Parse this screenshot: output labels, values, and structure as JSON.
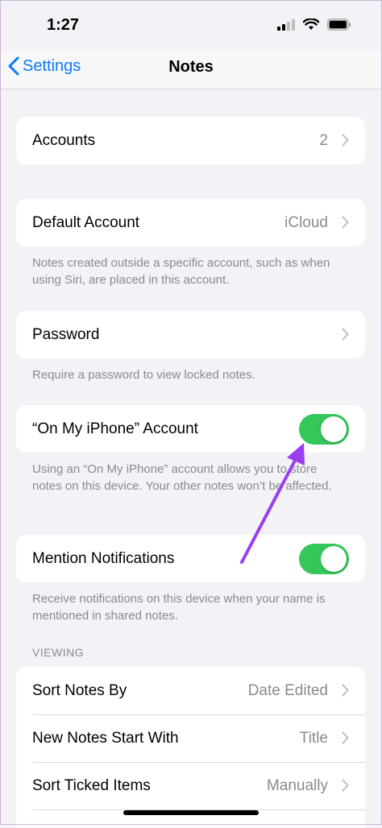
{
  "status_bar": {
    "time": "1:27"
  },
  "nav": {
    "back_label": "Settings",
    "title": "Notes"
  },
  "accounts": {
    "label": "Accounts",
    "value": "2"
  },
  "default_account": {
    "label": "Default Account",
    "value": "iCloud",
    "footer": "Notes created outside a specific account, such as when using Siri, are placed in this account."
  },
  "password": {
    "label": "Password",
    "footer": "Require a password to view locked notes."
  },
  "on_my_iphone": {
    "label": "“On My iPhone” Account",
    "enabled": true,
    "footer": "Using an “On My iPhone” account allows you to store notes on this device. Your other notes won’t be affected."
  },
  "mention_notifications": {
    "label": "Mention Notifications",
    "enabled": true,
    "footer": "Receive notifications on this device when your name is mentioned in shared notes."
  },
  "viewing": {
    "header": "VIEWING",
    "rows": [
      {
        "label": "Sort Notes By",
        "value": "Date Edited"
      },
      {
        "label": "New Notes Start With",
        "value": "Title"
      },
      {
        "label": "Sort Ticked Items",
        "value": "Manually"
      }
    ]
  },
  "colors": {
    "accent": "#0a7aff",
    "toggle_on": "#34c759",
    "annotation_arrow": "#9b3df0"
  },
  "icons": [
    "chevron-left-icon",
    "chevron-right-icon",
    "signal-icon",
    "wifi-icon",
    "battery-icon",
    "annotation-arrow-icon"
  ]
}
